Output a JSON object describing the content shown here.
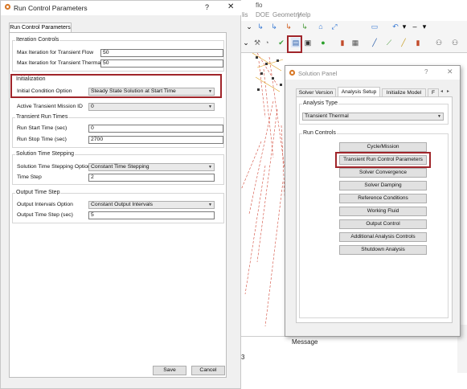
{
  "background_app": {
    "title_fragment": "flo",
    "menu": [
      "lis",
      "DOE",
      "Geometry",
      "Help"
    ],
    "message_header": "Message",
    "message_small": "3"
  },
  "run_control_dialog": {
    "title": "Run Control Parameters",
    "help_glyph": "?",
    "close_glyph": "✕",
    "tab_label": "Run Control Parameters",
    "iteration_controls": {
      "label": "Iteration Controls",
      "max_transient_flow_label": "Max Iteration for Transient Flow",
      "max_transient_flow_value": "50",
      "max_transient_thermal_label": "Max Iteration for Transient Thermal",
      "max_transient_thermal_value": "50"
    },
    "initialization": {
      "label": "Initialization",
      "initial_condition_label": "Initial Condition Option",
      "initial_condition_value": "Steady State Solution at Start Time"
    },
    "active_mission": {
      "label": "Active Transient Mission ID",
      "value": "0"
    },
    "transient_run_times": {
      "label": "Transient Run Times",
      "start_label": "Run Start Time (sec)",
      "start_value": "0",
      "stop_label": "Run Stop Time  (sec)",
      "stop_value": "2700"
    },
    "solution_time_stepping": {
      "label": "Solution Time Stepping",
      "option_label": "Solution Time Stepping Option",
      "option_value": "Constant Time Stepping",
      "step_label": "Time Step",
      "step_value": "2"
    },
    "output_time_step": {
      "label": "Output Time Step",
      "intervals_label": "Output Intervals Option",
      "intervals_value": "Constant Output Intervals",
      "step_label": "Output Time Step (sec)",
      "step_value": "5"
    },
    "save_label": "Save",
    "cancel_label": "Cancel"
  },
  "solution_panel": {
    "title": "Solution Panel",
    "help_glyph": "?",
    "close_glyph": "✕",
    "tabs": [
      "Solver Version",
      "Analysis Setup",
      "Initialize Model",
      "F"
    ],
    "analysis_type_label": "Analysis Type",
    "analysis_type_value": "Transient Thermal",
    "run_controls_label": "Run Controls",
    "buttons": [
      "Cycle/Mission",
      "Transient Run Control Parameters",
      "Solver Convergence",
      "Solver Damping",
      "Reference Conditions",
      "Working Fluid",
      "Output Control",
      "Additional Analysis Controls",
      "Shutdown Analysis"
    ]
  },
  "colors": {
    "highlight_red": "#a0252a",
    "dialog_bg": "#f0f0f0",
    "canvas_lines": "#d24a3a"
  }
}
